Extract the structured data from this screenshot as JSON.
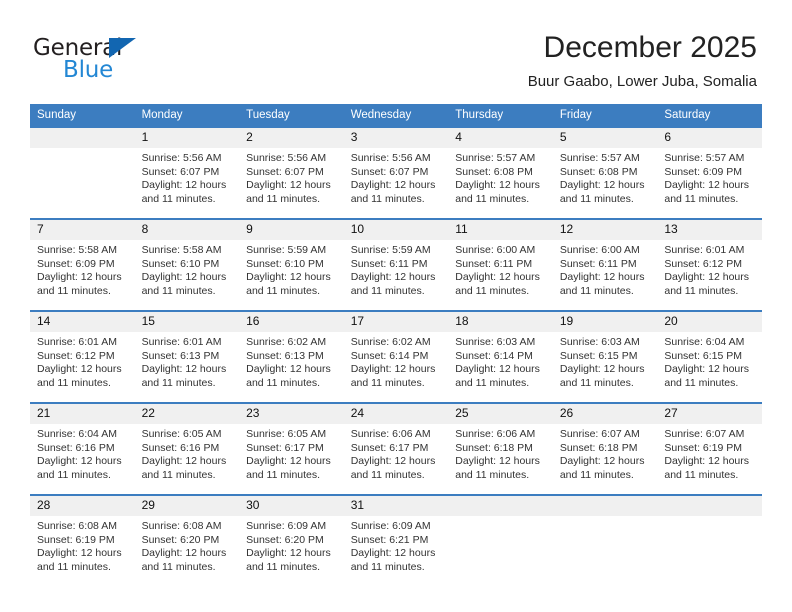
{
  "brand": {
    "name_part1": "General",
    "name_part2": "Blue",
    "triangle_color": "#1266b1",
    "blue_text_color": "#2387d4"
  },
  "header": {
    "title": "December 2025",
    "subtitle": "Buur Gaabo, Lower Juba, Somalia"
  },
  "theme": {
    "header_row_bg": "#3c7dc0",
    "daynum_bg": "#f0f0f0",
    "cell_bg": "#ffffff"
  },
  "weekdays": [
    "Sunday",
    "Monday",
    "Tuesday",
    "Wednesday",
    "Thursday",
    "Friday",
    "Saturday"
  ],
  "labels": {
    "sunrise_prefix": "Sunrise:",
    "sunset_prefix": "Sunset:",
    "daylight_prefix": "Daylight:"
  },
  "weeks": [
    [
      {
        "day": "",
        "empty": true
      },
      {
        "day": "1",
        "sunrise": "Sunrise: 5:56 AM",
        "sunset": "Sunset: 6:07 PM",
        "daylight_line1": "Daylight: 12 hours",
        "daylight_line2": "and 11 minutes."
      },
      {
        "day": "2",
        "sunrise": "Sunrise: 5:56 AM",
        "sunset": "Sunset: 6:07 PM",
        "daylight_line1": "Daylight: 12 hours",
        "daylight_line2": "and 11 minutes."
      },
      {
        "day": "3",
        "sunrise": "Sunrise: 5:56 AM",
        "sunset": "Sunset: 6:07 PM",
        "daylight_line1": "Daylight: 12 hours",
        "daylight_line2": "and 11 minutes."
      },
      {
        "day": "4",
        "sunrise": "Sunrise: 5:57 AM",
        "sunset": "Sunset: 6:08 PM",
        "daylight_line1": "Daylight: 12 hours",
        "daylight_line2": "and 11 minutes."
      },
      {
        "day": "5",
        "sunrise": "Sunrise: 5:57 AM",
        "sunset": "Sunset: 6:08 PM",
        "daylight_line1": "Daylight: 12 hours",
        "daylight_line2": "and 11 minutes."
      },
      {
        "day": "6",
        "sunrise": "Sunrise: 5:57 AM",
        "sunset": "Sunset: 6:09 PM",
        "daylight_line1": "Daylight: 12 hours",
        "daylight_line2": "and 11 minutes."
      }
    ],
    [
      {
        "day": "7",
        "sunrise": "Sunrise: 5:58 AM",
        "sunset": "Sunset: 6:09 PM",
        "daylight_line1": "Daylight: 12 hours",
        "daylight_line2": "and 11 minutes."
      },
      {
        "day": "8",
        "sunrise": "Sunrise: 5:58 AM",
        "sunset": "Sunset: 6:10 PM",
        "daylight_line1": "Daylight: 12 hours",
        "daylight_line2": "and 11 minutes."
      },
      {
        "day": "9",
        "sunrise": "Sunrise: 5:59 AM",
        "sunset": "Sunset: 6:10 PM",
        "daylight_line1": "Daylight: 12 hours",
        "daylight_line2": "and 11 minutes."
      },
      {
        "day": "10",
        "sunrise": "Sunrise: 5:59 AM",
        "sunset": "Sunset: 6:11 PM",
        "daylight_line1": "Daylight: 12 hours",
        "daylight_line2": "and 11 minutes."
      },
      {
        "day": "11",
        "sunrise": "Sunrise: 6:00 AM",
        "sunset": "Sunset: 6:11 PM",
        "daylight_line1": "Daylight: 12 hours",
        "daylight_line2": "and 11 minutes."
      },
      {
        "day": "12",
        "sunrise": "Sunrise: 6:00 AM",
        "sunset": "Sunset: 6:11 PM",
        "daylight_line1": "Daylight: 12 hours",
        "daylight_line2": "and 11 minutes."
      },
      {
        "day": "13",
        "sunrise": "Sunrise: 6:01 AM",
        "sunset": "Sunset: 6:12 PM",
        "daylight_line1": "Daylight: 12 hours",
        "daylight_line2": "and 11 minutes."
      }
    ],
    [
      {
        "day": "14",
        "sunrise": "Sunrise: 6:01 AM",
        "sunset": "Sunset: 6:12 PM",
        "daylight_line1": "Daylight: 12 hours",
        "daylight_line2": "and 11 minutes."
      },
      {
        "day": "15",
        "sunrise": "Sunrise: 6:01 AM",
        "sunset": "Sunset: 6:13 PM",
        "daylight_line1": "Daylight: 12 hours",
        "daylight_line2": "and 11 minutes."
      },
      {
        "day": "16",
        "sunrise": "Sunrise: 6:02 AM",
        "sunset": "Sunset: 6:13 PM",
        "daylight_line1": "Daylight: 12 hours",
        "daylight_line2": "and 11 minutes."
      },
      {
        "day": "17",
        "sunrise": "Sunrise: 6:02 AM",
        "sunset": "Sunset: 6:14 PM",
        "daylight_line1": "Daylight: 12 hours",
        "daylight_line2": "and 11 minutes."
      },
      {
        "day": "18",
        "sunrise": "Sunrise: 6:03 AM",
        "sunset": "Sunset: 6:14 PM",
        "daylight_line1": "Daylight: 12 hours",
        "daylight_line2": "and 11 minutes."
      },
      {
        "day": "19",
        "sunrise": "Sunrise: 6:03 AM",
        "sunset": "Sunset: 6:15 PM",
        "daylight_line1": "Daylight: 12 hours",
        "daylight_line2": "and 11 minutes."
      },
      {
        "day": "20",
        "sunrise": "Sunrise: 6:04 AM",
        "sunset": "Sunset: 6:15 PM",
        "daylight_line1": "Daylight: 12 hours",
        "daylight_line2": "and 11 minutes."
      }
    ],
    [
      {
        "day": "21",
        "sunrise": "Sunrise: 6:04 AM",
        "sunset": "Sunset: 6:16 PM",
        "daylight_line1": "Daylight: 12 hours",
        "daylight_line2": "and 11 minutes."
      },
      {
        "day": "22",
        "sunrise": "Sunrise: 6:05 AM",
        "sunset": "Sunset: 6:16 PM",
        "daylight_line1": "Daylight: 12 hours",
        "daylight_line2": "and 11 minutes."
      },
      {
        "day": "23",
        "sunrise": "Sunrise: 6:05 AM",
        "sunset": "Sunset: 6:17 PM",
        "daylight_line1": "Daylight: 12 hours",
        "daylight_line2": "and 11 minutes."
      },
      {
        "day": "24",
        "sunrise": "Sunrise: 6:06 AM",
        "sunset": "Sunset: 6:17 PM",
        "daylight_line1": "Daylight: 12 hours",
        "daylight_line2": "and 11 minutes."
      },
      {
        "day": "25",
        "sunrise": "Sunrise: 6:06 AM",
        "sunset": "Sunset: 6:18 PM",
        "daylight_line1": "Daylight: 12 hours",
        "daylight_line2": "and 11 minutes."
      },
      {
        "day": "26",
        "sunrise": "Sunrise: 6:07 AM",
        "sunset": "Sunset: 6:18 PM",
        "daylight_line1": "Daylight: 12 hours",
        "daylight_line2": "and 11 minutes."
      },
      {
        "day": "27",
        "sunrise": "Sunrise: 6:07 AM",
        "sunset": "Sunset: 6:19 PM",
        "daylight_line1": "Daylight: 12 hours",
        "daylight_line2": "and 11 minutes."
      }
    ],
    [
      {
        "day": "28",
        "sunrise": "Sunrise: 6:08 AM",
        "sunset": "Sunset: 6:19 PM",
        "daylight_line1": "Daylight: 12 hours",
        "daylight_line2": "and 11 minutes."
      },
      {
        "day": "29",
        "sunrise": "Sunrise: 6:08 AM",
        "sunset": "Sunset: 6:20 PM",
        "daylight_line1": "Daylight: 12 hours",
        "daylight_line2": "and 11 minutes."
      },
      {
        "day": "30",
        "sunrise": "Sunrise: 6:09 AM",
        "sunset": "Sunset: 6:20 PM",
        "daylight_line1": "Daylight: 12 hours",
        "daylight_line2": "and 11 minutes."
      },
      {
        "day": "31",
        "sunrise": "Sunrise: 6:09 AM",
        "sunset": "Sunset: 6:21 PM",
        "daylight_line1": "Daylight: 12 hours",
        "daylight_line2": "and 11 minutes."
      },
      {
        "day": "",
        "empty": true
      },
      {
        "day": "",
        "empty": true
      },
      {
        "day": "",
        "empty": true
      }
    ]
  ]
}
